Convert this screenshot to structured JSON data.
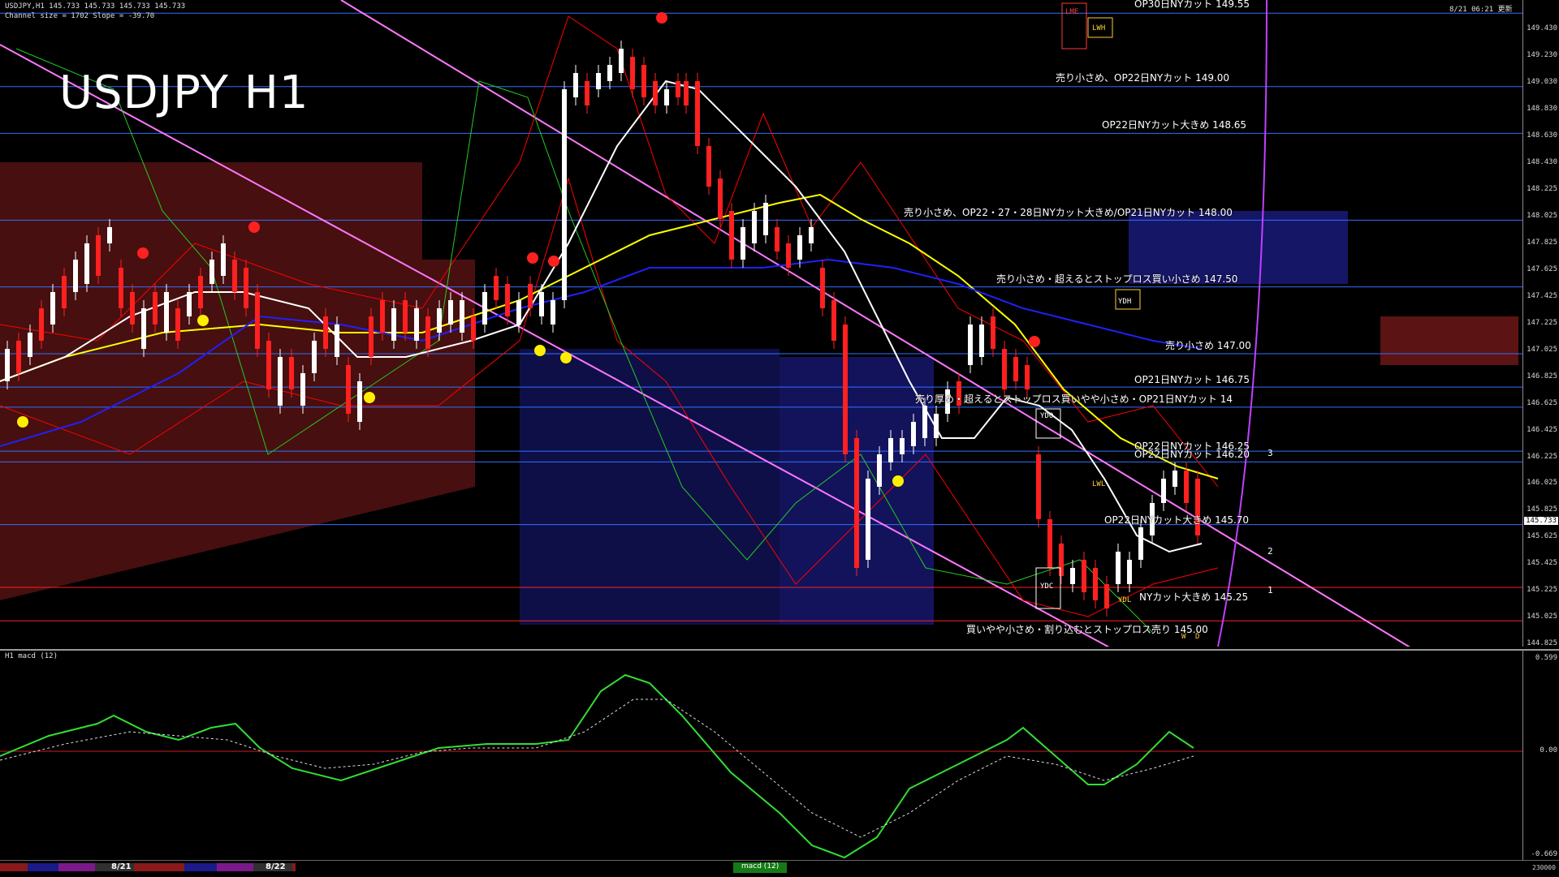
{
  "header": {
    "symbol_line": "USDJPY,H1  145.733 145.733 145.733 145.733",
    "channel_line": "Channel size = 1702 Slope = -39.70",
    "timestamp": "8/21 06:21 更新"
  },
  "title": "USDJPY H1",
  "price_axis": [
    "149.430",
    "149.230",
    "149.030",
    "148.830",
    "148.630",
    "148.430",
    "148.225",
    "148.025",
    "147.825",
    "147.625",
    "147.425",
    "147.225",
    "147.025",
    "146.825",
    "146.625",
    "146.425",
    "146.225",
    "146.025",
    "145.825",
    "145.625",
    "145.425",
    "145.225",
    "145.025",
    "144.825"
  ],
  "current_price": "145.733",
  "levels": [
    {
      "label": "OP30日NYカット 149.55",
      "price": 149.55
    },
    {
      "label": "売り小さめ、OP22日NYカット 149.00",
      "price": 149.0
    },
    {
      "label": "OP22日NYカット大きめ 148.65",
      "price": 148.65
    },
    {
      "label": "売り小さめ、OP22・27・28日NYカット大きめ/OP21日NYカット 148.00",
      "price": 148.0
    },
    {
      "label": "売り小さめ・超えるとストップロス買い小さめ 147.50",
      "price": 147.5
    },
    {
      "label": "売り小さめ 147.00",
      "price": 147.0
    },
    {
      "label": "OP21日NYカット 146.75",
      "price": 146.75
    },
    {
      "label": "売り厚め・超えるとストップロス買いやや小さめ・OP21日NYカット 14",
      "price": 146.6
    },
    {
      "label": "OP22日NYカット 146.25",
      "price": 146.27
    },
    {
      "label": "OP22日NYカット 146.20",
      "price": 146.19
    },
    {
      "label": "OP22日NYカット大きめ 145.70",
      "price": 145.72
    },
    {
      "label": "NYカット大きめ 145.25",
      "price": 145.25
    },
    {
      "label": "買いやや小さめ・割り込むとストップロス売り 145.00",
      "price": 145.0
    }
  ],
  "markers": {
    "m1": "1",
    "m2": "2",
    "m3": "3"
  },
  "boxes": {
    "ydh": "YDH",
    "ydo": "YDO",
    "ydc": "YDC",
    "ydl": "YDL",
    "lwh": "LWH",
    "lwl": "LWL",
    "lme": "LME",
    "w": "W",
    "d": "D"
  },
  "macd": {
    "label": "H1  macd (12)",
    "axis_top": "0.599",
    "axis_zero": "0.00",
    "axis_bottom": "-0.669"
  },
  "bottom_bar": {
    "date1": "8/21",
    "date2": "8/22",
    "tab": "macd (12)",
    "right_value": "230000"
  },
  "colors": {
    "price_up": "#ffffff",
    "price_down": "#ff2020",
    "ma_yellow": "#ffff00",
    "ma_white": "#ffffff",
    "ma_blue": "#2020ff",
    "envelope_red": "#ff0000",
    "envelope_green": "#22cc22",
    "channel_violet": "#ff77ff",
    "ichimoku_cloud_blue": "#2b2bcc",
    "ichimoku_cloud_red": "#cc2b2b",
    "level_blue": "#3070ff",
    "level_red": "#ff2020",
    "macd_green": "#33dd33",
    "macd_pink": "#ff8899"
  }
}
